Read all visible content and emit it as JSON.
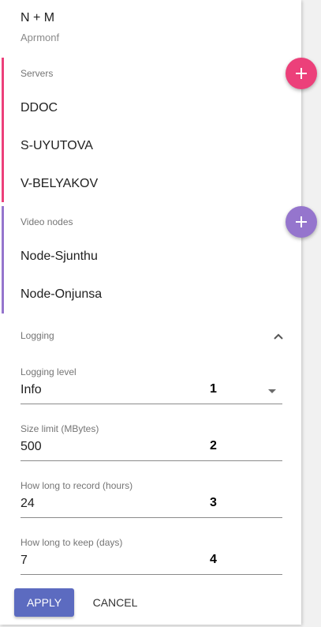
{
  "header": {
    "title": "N + M",
    "subtitle": "Aprmonf"
  },
  "servers": {
    "label": "Servers",
    "items": [
      "DDOC",
      "S-UYUTOVA",
      "V-BELYAKOV"
    ],
    "accent_color": "#ec407a",
    "add_icon": "plus-icon"
  },
  "video_nodes": {
    "label": "Video nodes",
    "items": [
      "Node-Sjunthu",
      "Node-Onjunsa"
    ],
    "accent_color": "#9575cd",
    "add_icon": "plus-icon"
  },
  "logging": {
    "label": "Logging",
    "expanded": true,
    "toggle_icon": "chevron-up-icon",
    "fields": [
      {
        "label": "Logging level",
        "value": "Info",
        "marker": "1",
        "type": "select"
      },
      {
        "label": "Size limit (MBytes)",
        "value": "500",
        "marker": "2"
      },
      {
        "label": "How long to record (hours)",
        "value": "24",
        "marker": "3"
      },
      {
        "label": "How long to keep (days)",
        "value": "7",
        "marker": "4"
      }
    ]
  },
  "actions": {
    "apply_label": "APPLY",
    "cancel_label": "CANCEL",
    "apply_color": "#5c6bc0"
  }
}
